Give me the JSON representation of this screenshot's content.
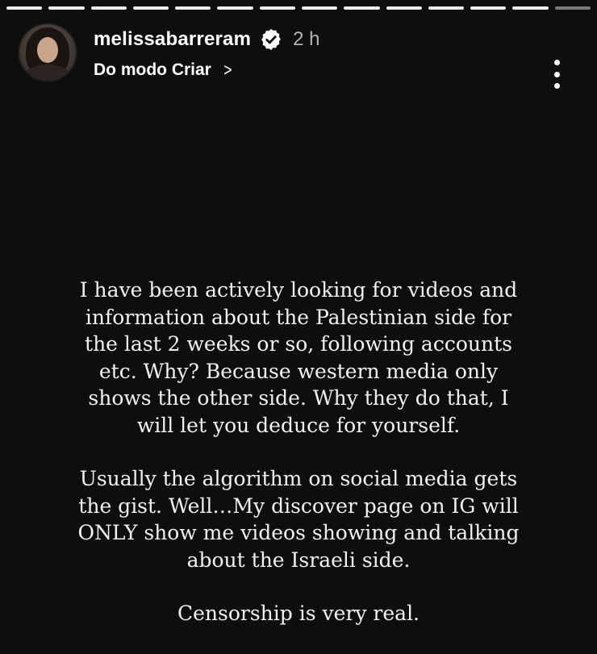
{
  "story": {
    "progress": {
      "segments_total": 14,
      "segments_viewed": 13
    },
    "header": {
      "username": "melissabarreram",
      "verified": true,
      "time_ago": "2 h",
      "mode_label": "Do modo Criar",
      "avatar_icon": "profile-photo",
      "more_icon": "more-vertical-icon",
      "chevron_icon": "chevron-right-icon",
      "chevron_glyph": ">"
    },
    "text": {
      "paragraph_1": "I have been actively looking for videos and information about the Palestinian side for the last 2 weeks or so, following accounts etc. Why? Because western media only shows the other side. Why they do that, I will let you deduce for yourself.",
      "paragraph_2": "Usually the algorithm on social media gets the gist. Well…My discover page on IG will ONLY show me videos showing and talking about the Israeli side.",
      "paragraph_3": "Censorship is very real."
    },
    "colors": {
      "background": "#0e0e0e",
      "text": "#f2f2f2",
      "muted": "#b3b3b3",
      "verified_badge": "#ffffff"
    }
  }
}
